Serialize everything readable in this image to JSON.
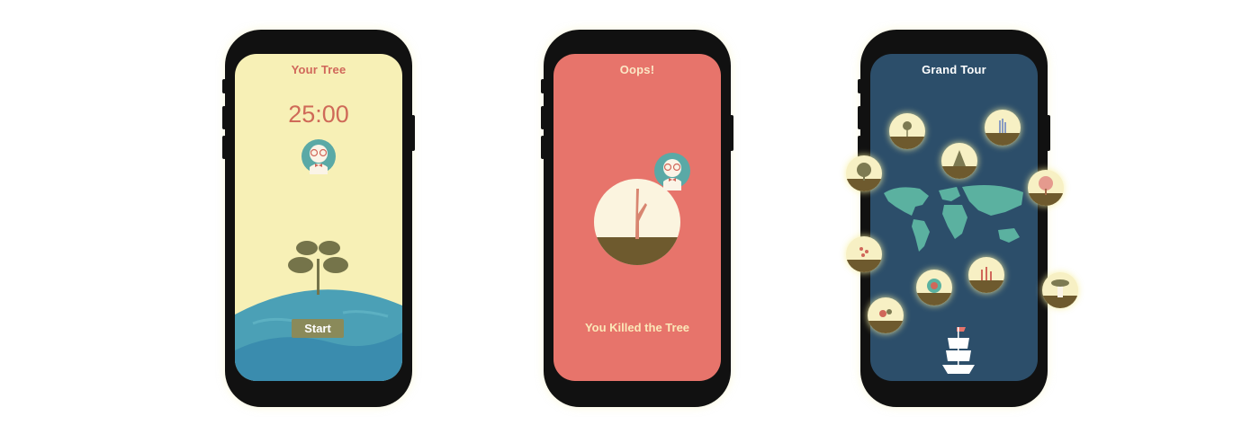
{
  "screens": [
    {
      "title": "Your Tree",
      "timer": "25:00",
      "start_label": "Start",
      "colors": {
        "background": "#f7f0b6",
        "title": "#d0675a",
        "timer": "#cf6a58",
        "ground": "#4ba0b6",
        "ground_dark": "#3a8cae",
        "plant": "#75744a"
      }
    },
    {
      "title": "Oops!",
      "message": "You Killed the Tree",
      "colors": {
        "background": "#e7746b",
        "title": "#fbe8c6",
        "message": "#fbe8b8",
        "circle": "#fbf4df",
        "soil": "#6e5a2e",
        "trunk": "#d88570"
      }
    },
    {
      "title": "Grand Tour",
      "colors": {
        "background": "#2c4e6a",
        "map": "#5bb1a0",
        "badge": "#f7f0c4",
        "soil": "#6e5a2e"
      },
      "badges": [
        "flower-tree",
        "sprout-tree",
        "pine-tree",
        "round-tree",
        "pink-tree",
        "berry-tree",
        "reed-tree",
        "melon-tree",
        "baobab-tree",
        "fruit-tree"
      ]
    }
  ]
}
